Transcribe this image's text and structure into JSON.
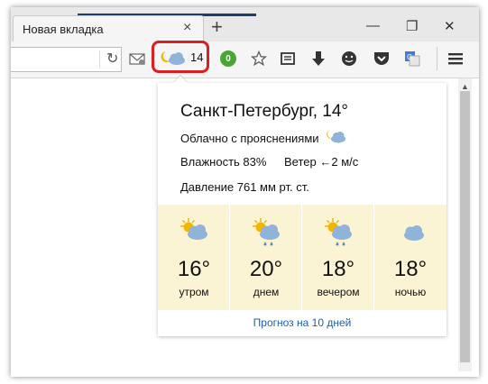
{
  "tab": {
    "title": "Новая вкладка",
    "close": "×",
    "new_tab": "+"
  },
  "window": {
    "minimize": "—",
    "restore": "❐",
    "close": "✕"
  },
  "toolbar": {
    "reload": "↻",
    "weather_temp": "14",
    "badge_count": "0",
    "icons": [
      "mail-icon",
      "weather-icon",
      "green-badge-icon",
      "star-icon",
      "reader-icon",
      "download-icon",
      "smiley-icon",
      "pocket-icon",
      "translate-icon",
      "menu-icon"
    ]
  },
  "weather": {
    "city": "Санкт-Петербург, 14°",
    "condition": "Облачно с прояснениями",
    "humidity": "Влажность 83%",
    "wind": "Ветер ←2 м/с",
    "pressure": "Давление 761 мм рт. ст.",
    "forecast": [
      {
        "temp": "16°",
        "label": "утром",
        "icon": "sun-cloud-icon"
      },
      {
        "temp": "20°",
        "label": "днем",
        "icon": "sun-cloud-rain-icon"
      },
      {
        "temp": "18°",
        "label": "вечером",
        "icon": "sun-cloud-rain-icon"
      },
      {
        "temp": "18°",
        "label": "ночью",
        "icon": "moon-cloud-icon"
      }
    ],
    "more_link": "Прогноз на 10 дней"
  },
  "colors": {
    "highlight": "#d91f1f",
    "forecast_bg": "#fbf4d4",
    "link": "#1f5fa8",
    "badge": "#49a635"
  }
}
